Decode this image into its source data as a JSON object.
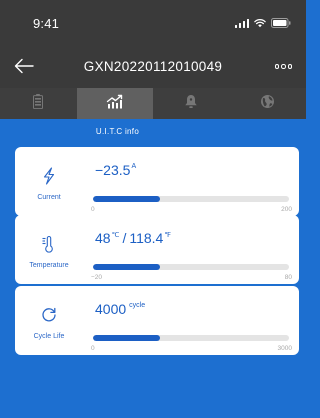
{
  "status_bar": {
    "time": "9:41"
  },
  "nav": {
    "title": "GXN20220112010049"
  },
  "tabs": [
    {
      "icon": "battery-icon",
      "active": false
    },
    {
      "icon": "chart-icon",
      "active": true
    },
    {
      "icon": "bell-icon",
      "active": false
    },
    {
      "icon": "globe-icon",
      "active": false
    }
  ],
  "section": {
    "title": "U.I.T.C info"
  },
  "cards": {
    "current": {
      "label": "Current",
      "value": "−23.5",
      "unit": "A",
      "min": "0",
      "max": "200",
      "fill_fraction": 0.34
    },
    "temperature": {
      "label": "Temperature",
      "celsius": "48",
      "celsius_unit": "℃",
      "separator": "/",
      "fahrenheit": "118.4",
      "fahrenheit_unit": "℉",
      "min": "−20",
      "max": "80",
      "fill_fraction": 0.34
    },
    "cycle": {
      "label": "Cycle Life",
      "value": "4000",
      "unit": "cycle",
      "min": "0",
      "max": "3000",
      "fill_fraction": 0.34
    }
  },
  "colors": {
    "background": "#1d6fd0",
    "header": "#3a3a3a",
    "accent": "#1c5fc4",
    "track": "#e4e4e4"
  }
}
